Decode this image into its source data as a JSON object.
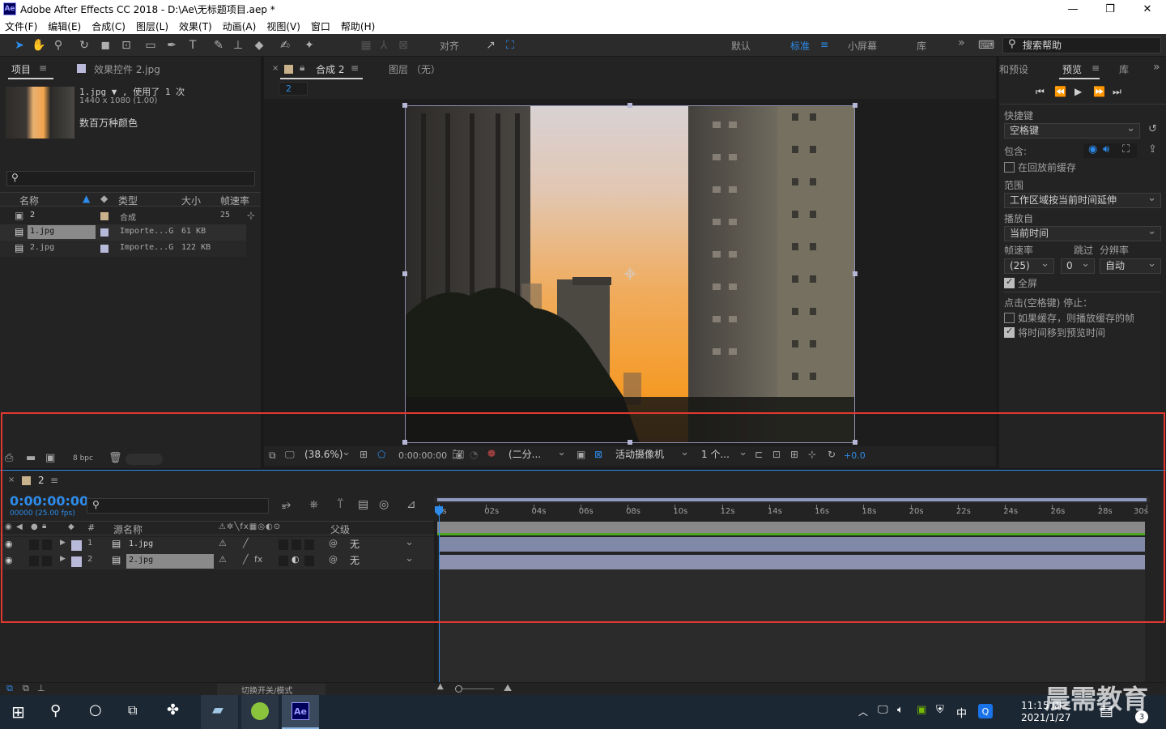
{
  "window": {
    "app_icon": "Ae",
    "title": "Adobe After Effects CC 2018 - D:\\Ae\\无标题项目.aep *",
    "minimize": "—",
    "maximize": "❐",
    "close": "✕"
  },
  "menu": [
    "文件(F)",
    "编辑(E)",
    "合成(C)",
    "图层(L)",
    "效果(T)",
    "动画(A)",
    "视图(V)",
    "窗口",
    "帮助(H)"
  ],
  "toolbar": {
    "snap_label": "对齐",
    "workspaces": [
      "默认",
      "标准",
      "小屏幕",
      "库"
    ],
    "active_workspace": "标准",
    "more": "»",
    "help_search_placeholder": "搜索帮助"
  },
  "project_panel": {
    "tabs": [
      "项目",
      "效果控件 2.jpg"
    ],
    "asset_name": "1.jpg ▼ , 使用了 1 次",
    "asset_dims": "1440 x 1080 (1.00)",
    "asset_color": "数百万种颜色",
    "search_placeholder": "",
    "columns": [
      "名称",
      "类型",
      "大小",
      "帧速率"
    ],
    "items": [
      {
        "name": "2",
        "type": "合成",
        "size": "",
        "fps": "25",
        "swatch": "#c9b28b"
      },
      {
        "name": "1.jpg",
        "type": "Importe...G",
        "size": "61 KB",
        "fps": "",
        "swatch": "#b9b9d9"
      },
      {
        "name": "2.jpg",
        "type": "Importe...G",
        "size": "122 KB",
        "fps": "",
        "swatch": "#b9b9d9"
      }
    ],
    "bpc": "8 bpc"
  },
  "comp_panel": {
    "tabs": [
      "合成 2",
      "图层 （无）"
    ],
    "comp_tab_label": "2",
    "footer": {
      "zoom": "(38.6%)",
      "timecode": "0:00:00:00",
      "resolution": "(二分...",
      "camera": "活动摄像机",
      "views": "1 个...",
      "exposure": "+0.0"
    }
  },
  "preview_panel": {
    "tabs": [
      "和预设",
      "预览",
      "库"
    ],
    "shortcut_label": "快捷键",
    "shortcut_value": "空格键",
    "include_label": "包含:",
    "cache_before": "在回放前缓存",
    "range_label": "范围",
    "range_value": "工作区域按当前时间延伸",
    "play_from_label": "播放自",
    "play_from_value": "当前时间",
    "fps_label": "帧速率",
    "skip_label": "跳过",
    "res_label": "分辨率",
    "fps_value": "(25)",
    "skip_value": "0",
    "res_value": "自动",
    "fullscreen": "全屏",
    "on_stop_label": "点击(空格键) 停止：",
    "opt_cache": "如果缓存，则播放缓存的帧",
    "opt_move": "将时间移到预览时间"
  },
  "timeline": {
    "comp_name": "2",
    "current_time": "0:00:00:00",
    "frame_info": "00000 (25.00 fps)",
    "search_placeholder": "",
    "col_hash": "#",
    "col_source": "源名称",
    "col_parent": "父级",
    "ruler": [
      "0s",
      "02s",
      "04s",
      "06s",
      "08s",
      "10s",
      "12s",
      "14s",
      "16s",
      "18s",
      "20s",
      "22s",
      "24s",
      "26s",
      "28s",
      "30s"
    ],
    "layers": [
      {
        "num": "1",
        "name": "1.jpg",
        "parent": "无"
      },
      {
        "num": "2",
        "name": "2.jpg",
        "parent": "无"
      }
    ],
    "toggle_label": "切换开关/模式"
  },
  "taskbar": {
    "time": "11:15 周三",
    "date": "2021/1/27",
    "ime": "中",
    "notif_count": "3",
    "watermark": "晨需教育"
  },
  "colors": {
    "accent": "#2d8ceb",
    "highlight_box": "#e0392f",
    "track_green": "#4caa1f"
  }
}
